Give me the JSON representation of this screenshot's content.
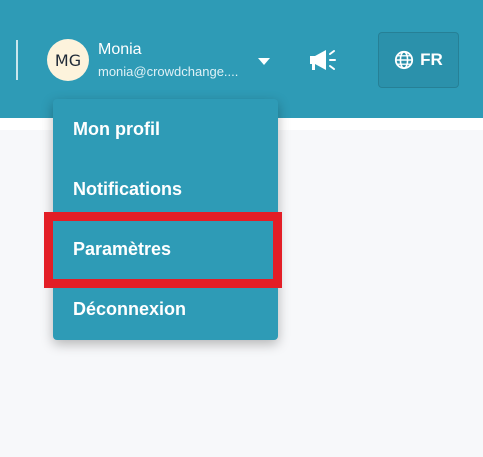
{
  "user": {
    "initials": "MG",
    "name": "Monia",
    "email": "monia@crowdchange...."
  },
  "header": {
    "language_label": "FR",
    "announce_icon": "megaphone-icon",
    "globe_icon": "globe-icon",
    "user_menu_icon": "chevron-down-icon"
  },
  "menu": {
    "items": [
      {
        "label": "Mon profil"
      },
      {
        "label": "Notifications"
      },
      {
        "label": "Paramètres"
      },
      {
        "label": "Déconnexion"
      }
    ]
  },
  "colors": {
    "primary": "#2e9bb6",
    "highlight": "#e31e26",
    "avatar_bg": "#fdf3dc",
    "background": "#f7f8fa"
  }
}
